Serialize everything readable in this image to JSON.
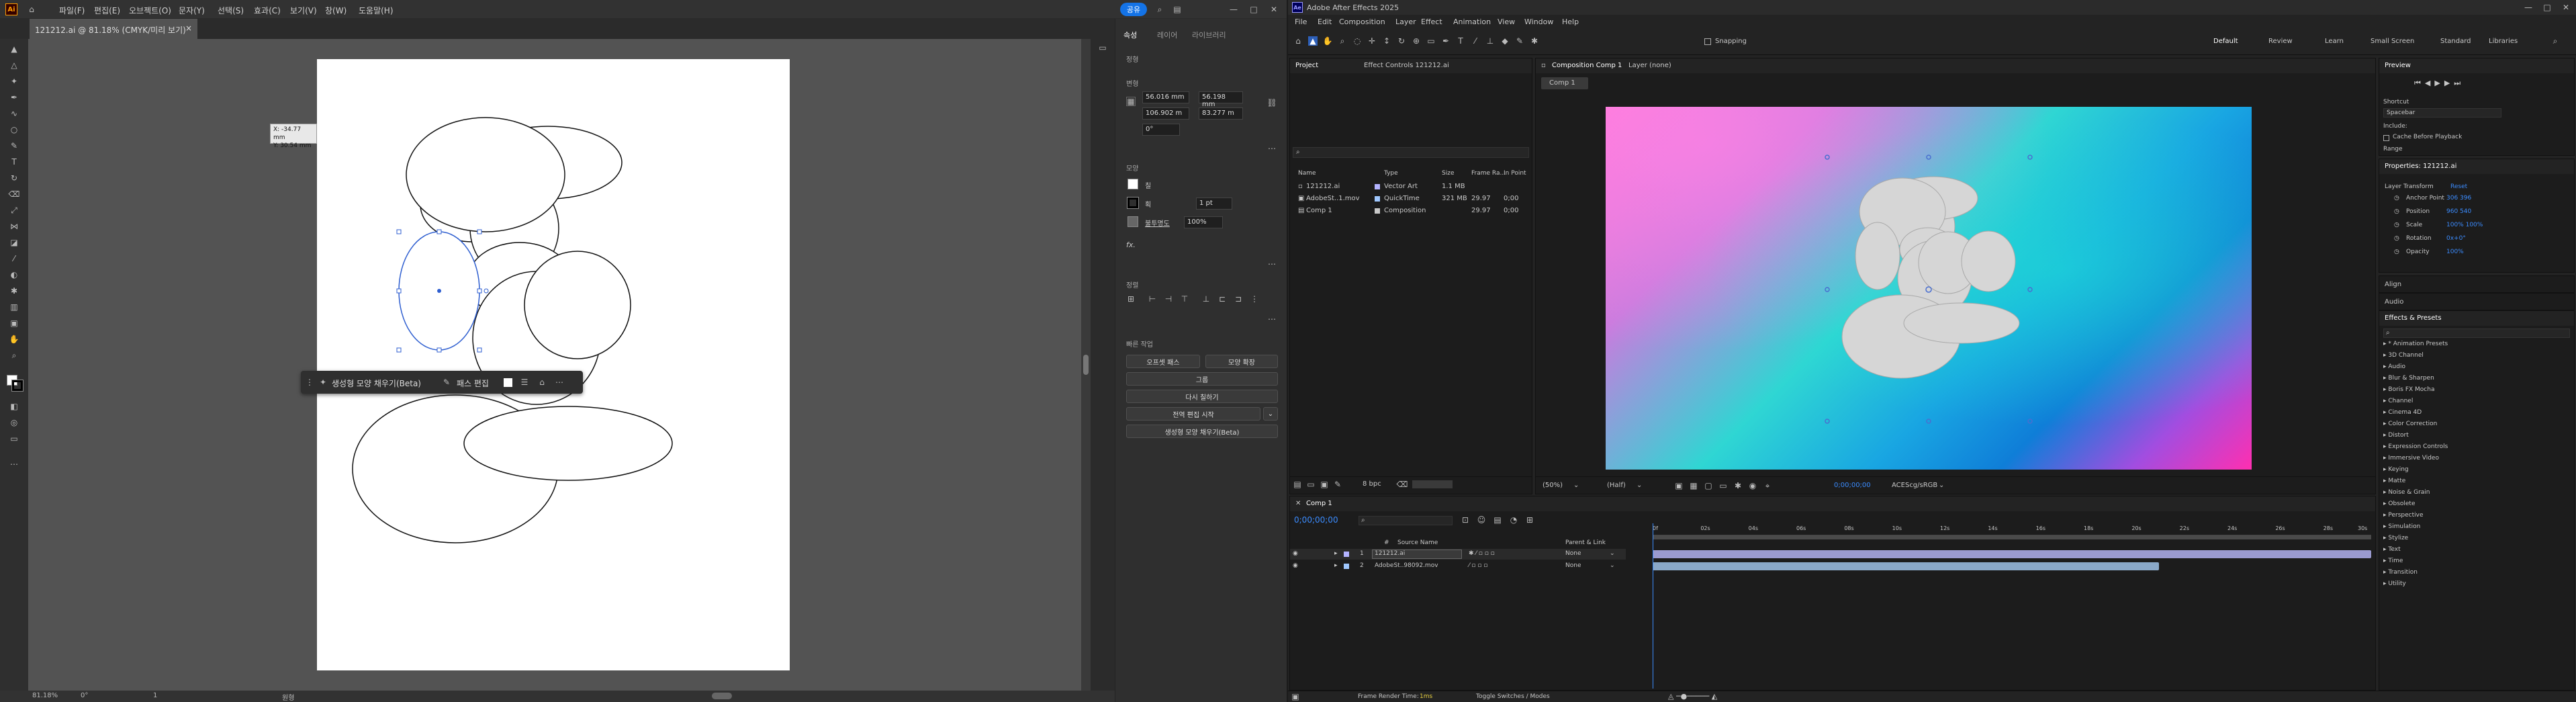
{
  "illustrator": {
    "logo": "Ai",
    "menu": [
      "파일(F)",
      "편집(E)",
      "오브젝트(O)",
      "문자(Y)",
      "선택(S)",
      "효과(C)",
      "보기(V)",
      "창(W)",
      "도움말(H)"
    ],
    "share_label": "공유",
    "doc_tab": "121212.ai @ 81.18% (CMYK/미리 보기)",
    "doc_tab_close": "×",
    "coord_tip": [
      "X: -34.77 mm",
      "Y: 30.54 mm"
    ],
    "context_toolbar": {
      "gen_fill": "생성형 모양 채우기(Beta)",
      "path_edit": "패스 편집"
    },
    "status": {
      "zoom": "81.18%",
      "rotation": "0°",
      "page": "1",
      "tool": "원형"
    },
    "props_tabs": [
      "속성",
      "레이어",
      "라이브러리"
    ],
    "props": {
      "section_color": "정형",
      "section_transform": "변형",
      "x": "56.016 mm",
      "y": "106.902 m",
      "w": "56.198 mm",
      "h": "83.277 m",
      "angle": "0°",
      "section_appearance": "모양",
      "fill_label": "칠",
      "stroke_label": "획",
      "stroke_value": "1 pt",
      "opacity_label": "불투명도",
      "opacity_value": "100%",
      "fx": "fx.",
      "section_align": "정렬",
      "section_quick": "빠른 작업",
      "btn_offset": "오프셋 패스",
      "btn_shape": "모양 확장",
      "btn_group": "그룹",
      "btn_recolor": "다시 칠하기",
      "btn_global_edit": "전역 편집 시작",
      "btn_gen_fill": "생성형 모양 채우기(Beta)"
    }
  },
  "after_effects": {
    "title": "Adobe After Effects 2025",
    "menu": [
      "File",
      "Edit",
      "Composition",
      "Layer",
      "Effect",
      "Animation",
      "View",
      "Window",
      "Help"
    ],
    "snapping": "Snapping",
    "workspaces": [
      "Default",
      "Review",
      "Learn",
      "Small Screen",
      "Standard",
      "Libraries"
    ],
    "project_tab": "Project",
    "effect_controls_tab": "Effect Controls 121212.ai",
    "project_columns": [
      "Name",
      "Type",
      "Size",
      "Frame Ra...",
      "In Point"
    ],
    "project_items": [
      {
        "name": "121212.ai",
        "type": "Vector Art",
        "size": "1.1 MB",
        "fps": "",
        "in": ""
      },
      {
        "name": "AdobeSt..1.mov",
        "type": "QuickTime",
        "size": "321 MB",
        "fps": "29.97",
        "in": "0;00"
      },
      {
        "name": "Comp 1",
        "type": "Composition",
        "size": "",
        "fps": "29.97",
        "in": "0;00"
      }
    ],
    "project_bpc": "8 bpc",
    "comp_tab": "Composition Comp 1",
    "layer_tab": "Layer (none)",
    "comp_subtab": "Comp 1",
    "viewer_footer": {
      "zoom": "(50%)",
      "res": "(Half)",
      "timecode": "0;00;00;00",
      "color": "ACEScg/sRGB"
    },
    "timeline_tab": "Comp 1",
    "timecode": "0;00;00;00",
    "layer_columns": [
      "#",
      "Source Name",
      "Parent & Link"
    ],
    "layers": [
      {
        "num": "1",
        "name": "121212.ai",
        "parent": "None"
      },
      {
        "num": "2",
        "name": "AdobeSt..98092.mov",
        "parent": "None"
      }
    ],
    "ruler": [
      "0f",
      "02s",
      "04s",
      "06s",
      "08s",
      "10s",
      "12s",
      "14s",
      "16s",
      "18s",
      "20s",
      "22s",
      "24s",
      "26s",
      "28s",
      "30s"
    ],
    "footer": {
      "render_label": "Frame Render Time:",
      "render_value": "1ms",
      "toggle": "Toggle Switches / Modes"
    },
    "preview_tab": "Preview",
    "shortcut_label": "Shortcut",
    "shortcut_value": "Spacebar",
    "include_label": "Include:",
    "cache_label": "Cache Before Playback",
    "range_label": "Range",
    "properties_tab": "Properties: 121212.ai",
    "layer_transform": "Layer Transform",
    "reset": "Reset",
    "transform_props": [
      {
        "name": "Anchor Point",
        "value": "306   396"
      },
      {
        "name": "Position",
        "value": "960   540"
      },
      {
        "name": "Scale",
        "value": "100%   100%"
      },
      {
        "name": "Rotation",
        "value": "0x+0°"
      },
      {
        "name": "Opacity",
        "value": "100%"
      }
    ],
    "align_tab": "Align",
    "audio_tab": "Audio",
    "effects_tab": "Effects & Presets",
    "effects": [
      "* Animation Presets",
      "3D Channel",
      "Audio",
      "Blur & Sharpen",
      "Boris FX Mocha",
      "Channel",
      "Cinema 4D",
      "Color Correction",
      "Distort",
      "Expression Controls",
      "Immersive Video",
      "Keying",
      "Matte",
      "Noise & Grain",
      "Obsolete",
      "Perspective",
      "Simulation",
      "Stylize",
      "Text",
      "Time",
      "Transition",
      "Utility"
    ]
  }
}
